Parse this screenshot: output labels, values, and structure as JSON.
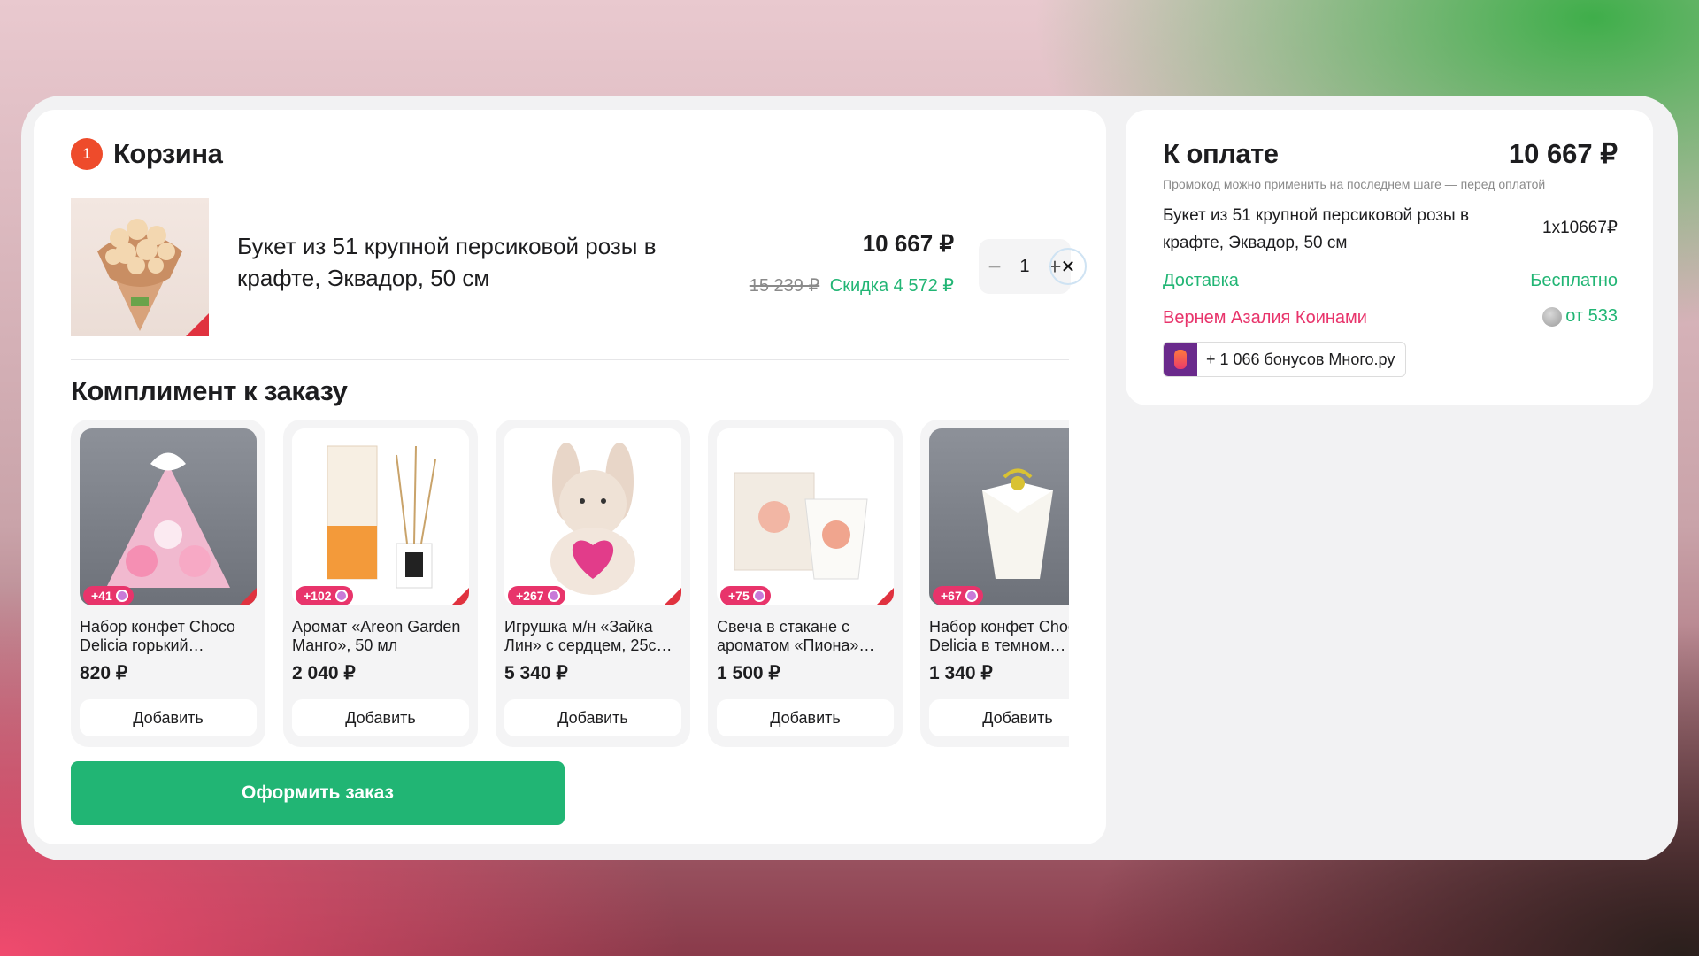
{
  "cart": {
    "count": "1",
    "title": "Корзина",
    "item": {
      "name": "Букет из 51 крупной персиковой розы в крафте, Эквадор, 50 см",
      "price": "10 667 ₽",
      "old_price": "15 239 ₽",
      "discount": "Скидка 4 572 ₽",
      "qty": "1",
      "minus": "−",
      "plus": "+",
      "remove": "✕"
    },
    "compliment_title": "Комплимент к заказу",
    "products": [
      {
        "name": "Набор конфет Choco Delicia горький…",
        "price": "820 ₽",
        "bonus": "+41",
        "add": "Добавить"
      },
      {
        "name": "Аромат «Areon Garden Манго», 50 мл",
        "price": "2 040 ₽",
        "bonus": "+102",
        "add": "Добавить"
      },
      {
        "name": "Игрушка м/н «Зайка Лин» с сердцем, 25с…",
        "price": "5 340 ₽",
        "bonus": "+267",
        "add": "Добавить"
      },
      {
        "name": "Свеча в стакане с ароматом «Пиона»…",
        "price": "1 500 ₽",
        "bonus": "+75",
        "add": "Добавить"
      },
      {
        "name": "Набор конфет Choco Delicia в темном…",
        "price": "1 340 ₽",
        "bonus": "+67",
        "add": "Добавить"
      }
    ],
    "checkout_label": "Оформить заказ"
  },
  "payment": {
    "title": "К оплате",
    "total": "10 667 ₽",
    "note": "Промокод можно применить на последнем шаге — перед оплатой",
    "item_name": "Букет из 51 крупной персиковой розы в крафте, Эквадор, 50 см",
    "item_qty": "1x10667₽",
    "delivery_label": "Доставка",
    "delivery_value": "Бесплатно",
    "coins_label": "Вернем Азалия Коинами",
    "coins_value": "от 533",
    "bonus_text": "+ 1 066 бонусов Много.ру"
  },
  "colors": {
    "accent_green": "#21b574",
    "accent_pink": "#e8346b",
    "badge_red": "#ee4b2b"
  }
}
